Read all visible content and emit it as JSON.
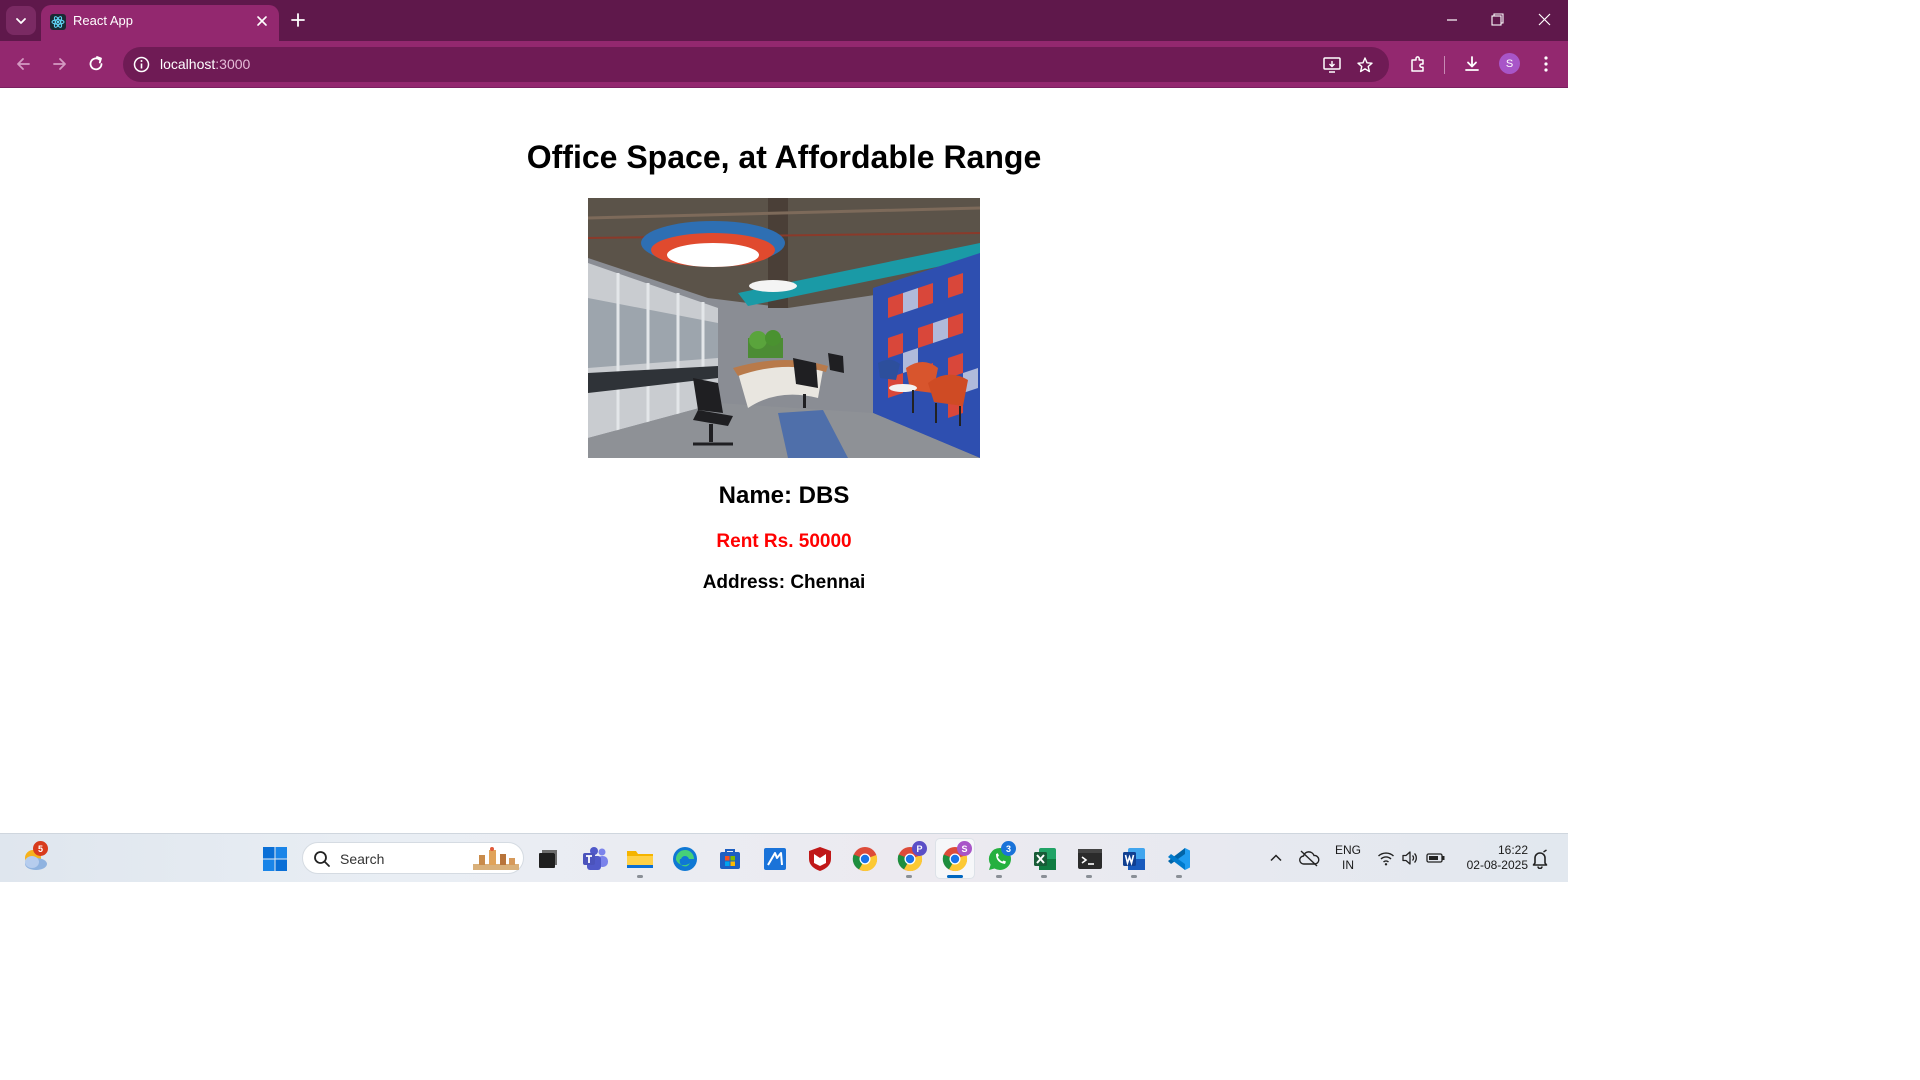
{
  "browser": {
    "tab": {
      "title": "React App",
      "favicon": "react-icon"
    },
    "url_host": "localhost",
    "url_port": ":3000",
    "profile_initial": "S",
    "theme_color": "#93286f"
  },
  "page": {
    "title": "Office Space, at Affordable Range",
    "image_alt": "office-interior-photo",
    "name_label": "Name: DBS",
    "rent_label": "Rent Rs. 50000",
    "rent_color": "#ff0000",
    "address_label": "Address: Chennai"
  },
  "taskbar": {
    "widgets_badge": "5",
    "search_placeholder": "Search",
    "chrome_p_badge": "P",
    "chrome_s_badge": "S",
    "whatsapp_badge": "3",
    "lang_top": "ENG",
    "lang_bottom": "IN",
    "time": "16:22",
    "date": "02-08-2025"
  }
}
